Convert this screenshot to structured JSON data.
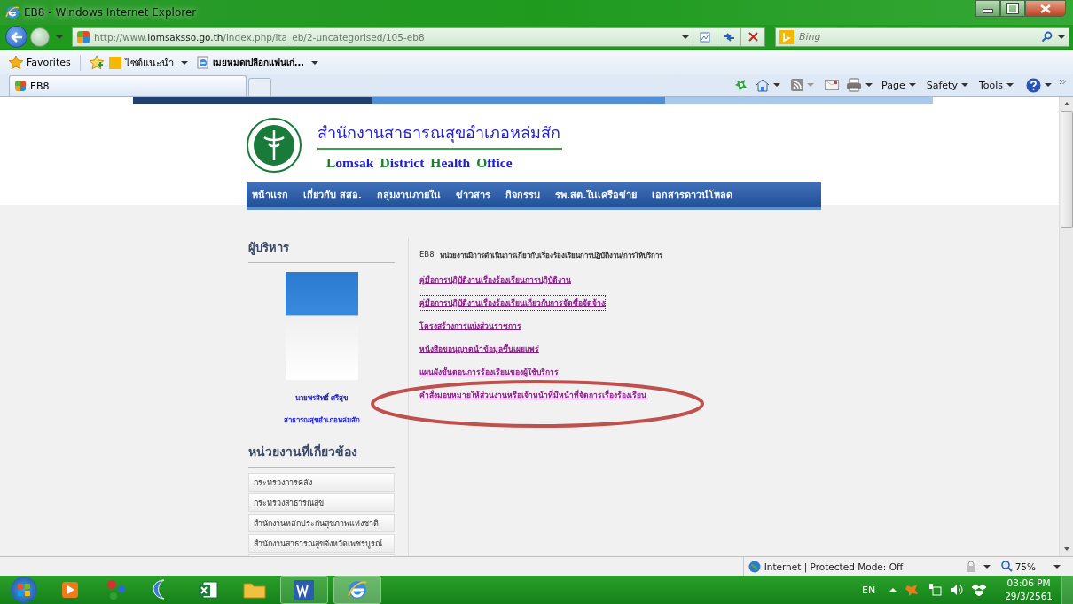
{
  "window": {
    "title": "EB8 - Windows Internet Explorer"
  },
  "address_bar": {
    "url": "http://www.**lomsaksso.go.th**/index.php/ita_eb/2-uncategorised/105-eb8"
  },
  "search": {
    "placeholder": "Bing"
  },
  "favorites_bar": {
    "items": [
      {
        "label": "Favorites"
      },
      {
        "label": "ไซต์แนะนำ"
      },
      {
        "label": "เมยหมดเปลือกแฟนเก่..."
      }
    ]
  },
  "tabs": [
    {
      "label": "EB8",
      "selected": true
    }
  ],
  "command_bar": [
    "Page",
    "Safety",
    "Tools"
  ],
  "site": {
    "title_th": "สำนักงานสาธารณสุขอำเภอหล่มสัก",
    "title_en": "Lomsak District Health Office",
    "nav": [
      "หน้าแรก",
      "เกี่ยวกับ สสอ.",
      "กลุ่มงานภายใน",
      "ข่าวสาร",
      "กิจกรรม",
      "รพ.สต.ในเครือข่าย",
      "เอกสารดาวน์โหลด"
    ]
  },
  "sidebar": {
    "executive_heading": "ผู้บริหาร",
    "person_name": "นายพรสิทธิ์  ศรีสุข",
    "person_title": "สาธารณสุขอำเภอหล่มสัก",
    "related_heading": "หน่วยงานที่เกี่ยวข้อง",
    "related_links": [
      "กระทรวงการคลัง",
      "กระทรวงสาธารณสุข",
      "สำนักงานหลักประกันสุขภาพแห่งชาติ",
      "สำนักงานสาธารณสุขจังหวัดเพชรบูรณ์"
    ]
  },
  "content": {
    "code": "EB8",
    "heading": "หน่วยงานมีการดำเนินการเกี่ยวกับเรื่องร้องเรียนการปฏิบัติงาน/การให้บริการ",
    "links": [
      {
        "label": "คู่มือการปฏิบัติงานเรื่องร้องเรียนการปฏิบัติงาน",
        "focused": false
      },
      {
        "label": "คู่มือการปฏิบัติงานเรื่องร้องเรียนเกี่ยวกับการจัดซื้อจัดจ้าง",
        "focused": true
      },
      {
        "label": "โครงสร้างการแบ่งส่วนราชการ",
        "focused": false
      },
      {
        "label": "หนังสือขอนุญาตนำข้อมูลขึ้นเผยแพร่",
        "focused": false
      },
      {
        "label": "แผนผังขั้นตอนการร้องเรียนของผู้ใช้บริการ",
        "focused": false
      },
      {
        "label": "คำสั่งมอบหมายให้ส่วนงานหรือเจ้าหน้าที่มีหน้าที่จัดการเรื่องร้องเรียน",
        "focused": false
      }
    ]
  },
  "status_bar": {
    "zone": "Internet | Protected Mode: Off",
    "zoom": "75%"
  },
  "taskbar": {
    "language": "EN",
    "time": "03:06 PM",
    "date": "29/3/2561"
  }
}
